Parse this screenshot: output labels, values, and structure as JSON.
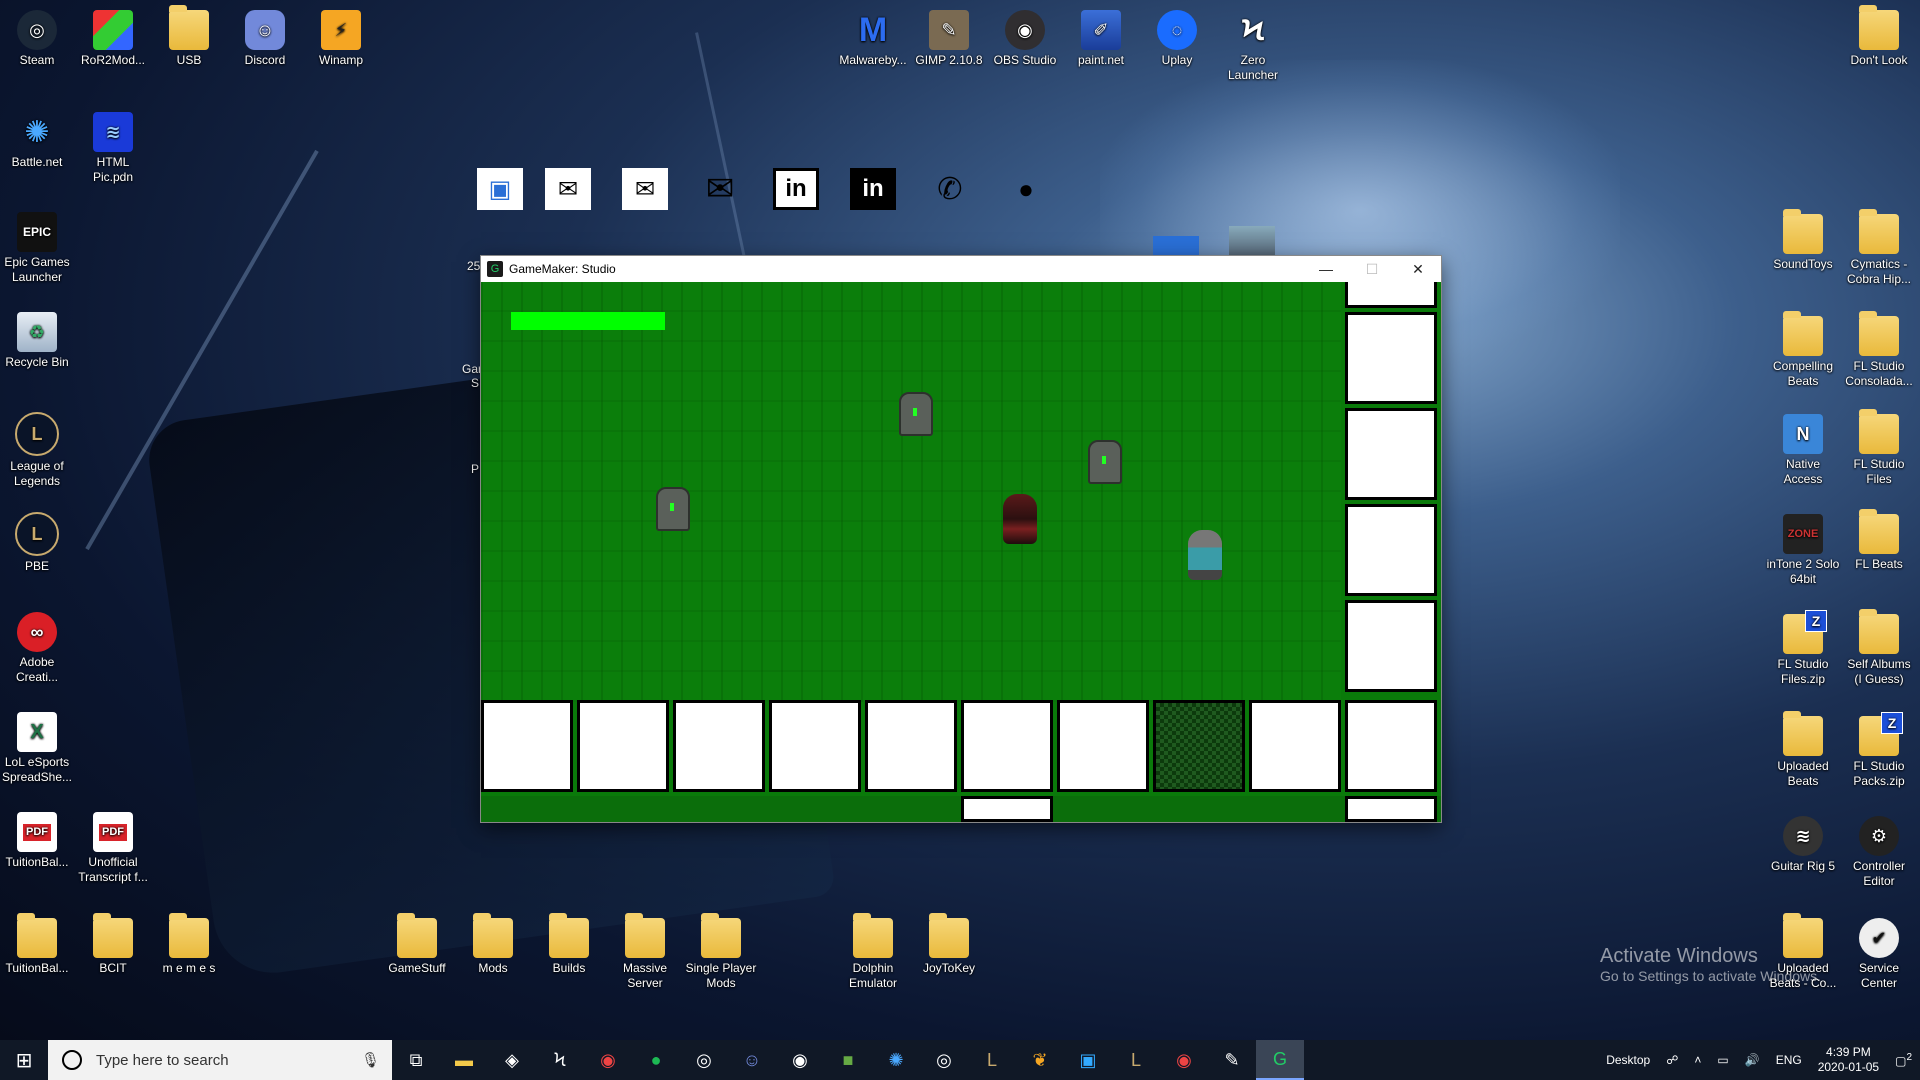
{
  "desktop": {
    "icons_left": [
      {
        "label": "Steam",
        "icon": "steam-icon"
      },
      {
        "label": "RoR2Mod...",
        "icon": "cube-icon"
      },
      {
        "label": "USB",
        "icon": "folder-icon"
      },
      {
        "label": "Discord",
        "icon": "discord-icon"
      },
      {
        "label": "Winamp",
        "icon": "winamp-icon"
      },
      {
        "label": "Battle.net",
        "icon": "battlenet-icon"
      },
      {
        "label": "HTML Pic.pdn",
        "icon": "paintnet-file-icon"
      },
      {
        "label": "Epic Games Launcher",
        "icon": "epic-icon"
      },
      {
        "label": "Recycle Bin",
        "icon": "recycle-bin-icon"
      },
      {
        "label": "League of Legends",
        "icon": "league-icon"
      },
      {
        "label": "PBE",
        "icon": "league-icon"
      },
      {
        "label": "Adobe Creati...",
        "icon": "adobe-cc-icon"
      },
      {
        "label": "LoL eSports SpreadShe...",
        "icon": "excel-icon"
      },
      {
        "label": "TuitionBal...",
        "icon": "pdf-icon"
      },
      {
        "label": "Unofficial Transcript f...",
        "icon": "pdf-icon"
      }
    ],
    "icons_bottom": [
      {
        "label": "TuitionBal...",
        "icon": "folder-icon"
      },
      {
        "label": "BCIT",
        "icon": "folder-icon"
      },
      {
        "label": "m e m e s",
        "icon": "folder-icon"
      },
      {
        "label": "GameStuff",
        "icon": "folder-icon"
      },
      {
        "label": "Mods",
        "icon": "folder-icon"
      },
      {
        "label": "Builds",
        "icon": "folder-icon"
      },
      {
        "label": "Massive Server",
        "icon": "folder-icon"
      },
      {
        "label": "Single Player Mods",
        "icon": "folder-icon"
      },
      {
        "label": "Dolphin Emulator",
        "icon": "folder-icon"
      },
      {
        "label": "JoyToKey",
        "icon": "folder-icon"
      }
    ],
    "icons_top": [
      {
        "label": "Malwareby...",
        "icon": "malwarebytes-icon"
      },
      {
        "label": "GIMP 2.10.8",
        "icon": "gimp-icon"
      },
      {
        "label": "OBS Studio",
        "icon": "obs-icon"
      },
      {
        "label": "paint.net",
        "icon": "paintnet-icon"
      },
      {
        "label": "Uplay",
        "icon": "uplay-icon"
      },
      {
        "label": "Zero Launcher",
        "icon": "zero-launcher-icon"
      },
      {
        "label": "Don't Look",
        "icon": "folder-icon"
      }
    ],
    "icons_right": [
      {
        "label": "SoundToys",
        "icon": "folder-icon"
      },
      {
        "label": "Cymatics - Cobra Hip...",
        "icon": "folder-icon"
      },
      {
        "label": "Compelling Beats",
        "icon": "folder-icon"
      },
      {
        "label": "FL Studio Consolada...",
        "icon": "folder-icon"
      },
      {
        "label": "Native Access",
        "icon": "native-access-icon"
      },
      {
        "label": "FL Studio Files",
        "icon": "folder-icon"
      },
      {
        "label": "inTone 2 Solo 64bit",
        "icon": "intone-icon"
      },
      {
        "label": "FL Beats",
        "icon": "folder-icon"
      },
      {
        "label": "FL Studio Files.zip",
        "icon": "zip-icon"
      },
      {
        "label": "Self Albums (I Guess)",
        "icon": "folder-icon"
      },
      {
        "label": "Uploaded Beats",
        "icon": "folder-icon"
      },
      {
        "label": "FL Studio Packs.zip",
        "icon": "zip-icon"
      },
      {
        "label": "Guitar Rig 5",
        "icon": "guitar-rig-icon"
      },
      {
        "label": "Controller Editor",
        "icon": "controller-editor-icon"
      },
      {
        "label": "Uploaded Beats - Co...",
        "icon": "folder-icon"
      },
      {
        "label": "Service Center",
        "icon": "service-center-icon"
      }
    ],
    "partial_labels": {
      "a": "25",
      "b": "Gar",
      "c": "S",
      "d": "P"
    }
  },
  "window": {
    "title": "GameMaker: Studio",
    "controls": {
      "minimize": "—",
      "maximize": "☐",
      "close": "✕"
    }
  },
  "game": {
    "health_fraction": 1.0,
    "colors": {
      "grass": "#0b7e0b",
      "health": "#00ff00",
      "slot": "#ffffff"
    }
  },
  "watermark": {
    "line1": "Activate Windows",
    "line2": "Go to Settings to activate Windows."
  },
  "taskbar": {
    "search_placeholder": "Type here to search",
    "desktop_label": "Desktop",
    "lang": "ENG",
    "time": "4:39 PM",
    "date": "2020-01-05",
    "notification_count": "2"
  }
}
